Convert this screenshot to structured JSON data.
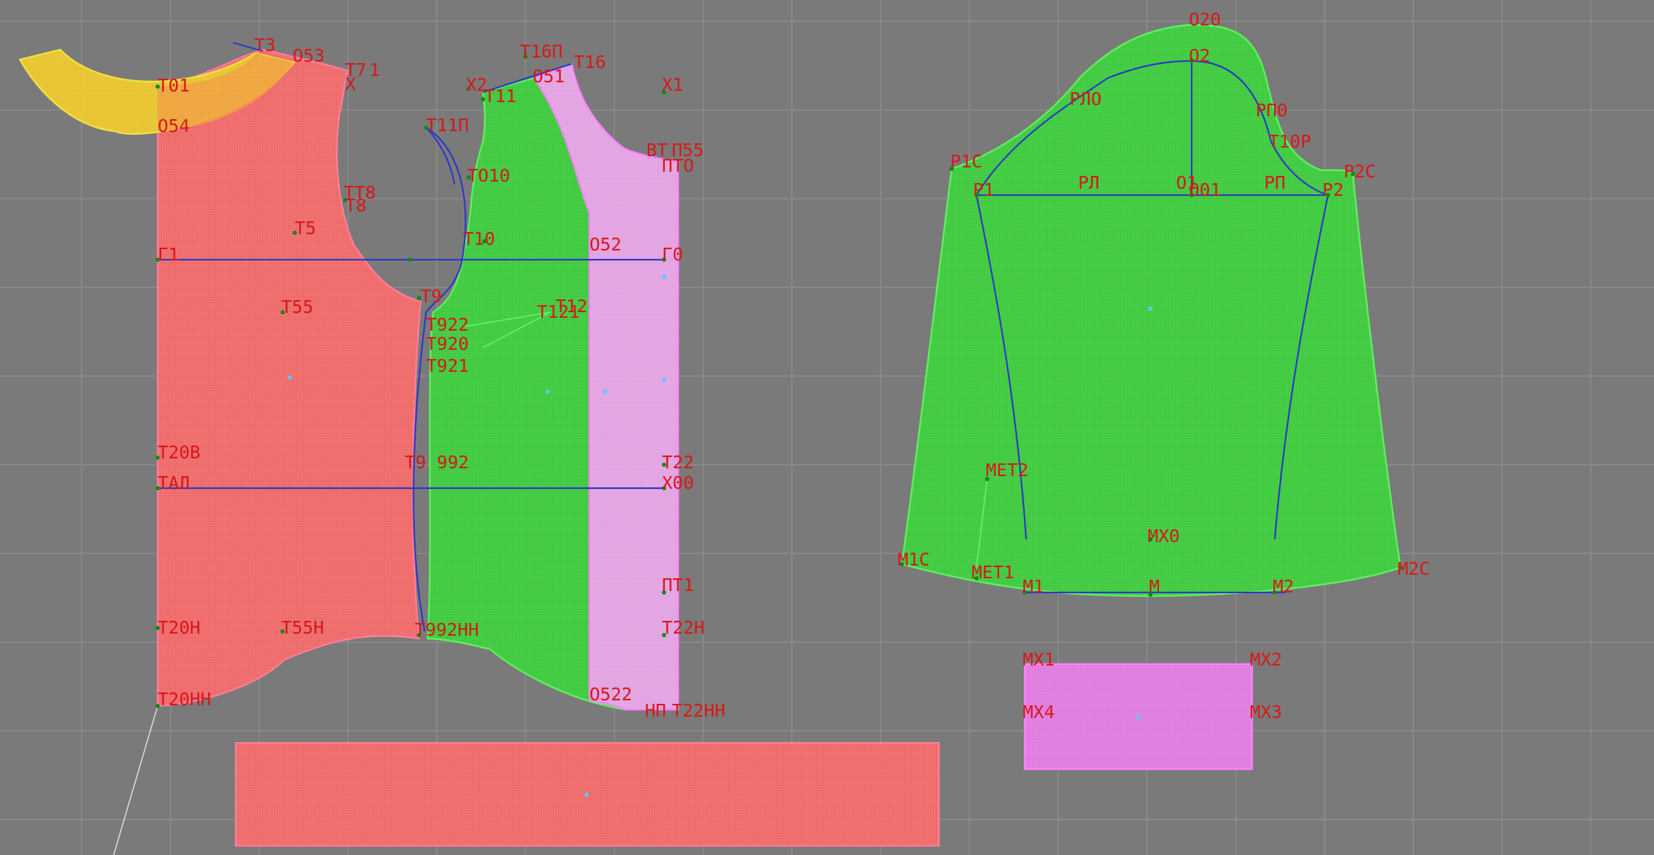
{
  "colors": {
    "background": "#7a7a7a",
    "grid": "#8c8c8c",
    "label": "#d81818",
    "piece_red": "#ef6a6a",
    "piece_green": "#3fca3f",
    "piece_pink": "#e2a3e2",
    "piece_magenta": "#e07ce0",
    "piece_yellow": "#e8c430",
    "construction_line": "#2b38c8"
  },
  "labels": {
    "neck_T3": "Т3",
    "neck_O53": "О53",
    "neck_T7": "Т7",
    "neck_T71": "1",
    "neck_X": "Х",
    "neck_T01": "Т01",
    "neck_O54": "О54",
    "back_TT8": "ТТ8",
    "back_T8": "Т8",
    "back_T5": "Т5",
    "back_G1": "Г1",
    "back_T55": "Т55",
    "back_T20V": "Т20В",
    "back_TAL": "ТАЛ",
    "back_T20N": "Т20Н",
    "back_T55N": "Т55Н",
    "back_T20NN": "Т20НН",
    "mid_T16P": "Т16П",
    "mid_T16": "Т16",
    "mid_O51": "О51",
    "mid_X2": "Х2",
    "mid_T11": "Т11",
    "mid_X1": "Х1",
    "mid_T11P": "Т11П",
    "mid_VT": "ВТ",
    "mid_P55": "П55",
    "mid_PTO": "ПТО",
    "mid_TO10": "ТО10",
    "mid_T10": "Т10",
    "mid_O52": "О52",
    "mid_G0": "Г0",
    "mid_T9": "Т9",
    "mid_T922": "Т922",
    "mid_T12": "Т12",
    "mid_T121": "Т121",
    "mid_T920": "Т920",
    "mid_T921": "Т921",
    "mid_T992": "Т9 992",
    "mid_T22": "Т22",
    "mid_X00": "Х00",
    "mid_PT1": "ПТ1",
    "mid_T22N": "Т22Н",
    "mid_T99N": "Т992НН",
    "mid_O522": "О522",
    "mid_NP": "НП",
    "mid_T22NN": "Т22НН",
    "sleeve_O20": "О20",
    "sleeve_O2": "О2",
    "sleeve_RP0_left": "РЛО",
    "sleeve_RP0": "РП0",
    "sleeve_T10R": "Т10Р",
    "sleeve_R1C": "Р1С",
    "sleeve_R1": "Р1",
    "sleeve_RL": "РЛ",
    "sleeve_O1": "О1",
    "sleeve_O01": "О01",
    "sleeve_RP": "РП",
    "sleeve_R2": "Р2",
    "sleeve_R2C": "Р2С",
    "sleeve_MET2": "МЕТ2",
    "sleeve_MX0": "МХ0",
    "sleeve_M1C": "М1С",
    "sleeve_MET1": "МЕТ1",
    "sleeve_M1": "М1",
    "sleeve_M": "М",
    "sleeve_M2": "М2",
    "sleeve_M2C": "М2С",
    "cuff_MX1": "МХ1",
    "cuff_MX2": "МХ2",
    "cuff_MX4": "МХ4",
    "cuff_MX3": "МХ3"
  }
}
